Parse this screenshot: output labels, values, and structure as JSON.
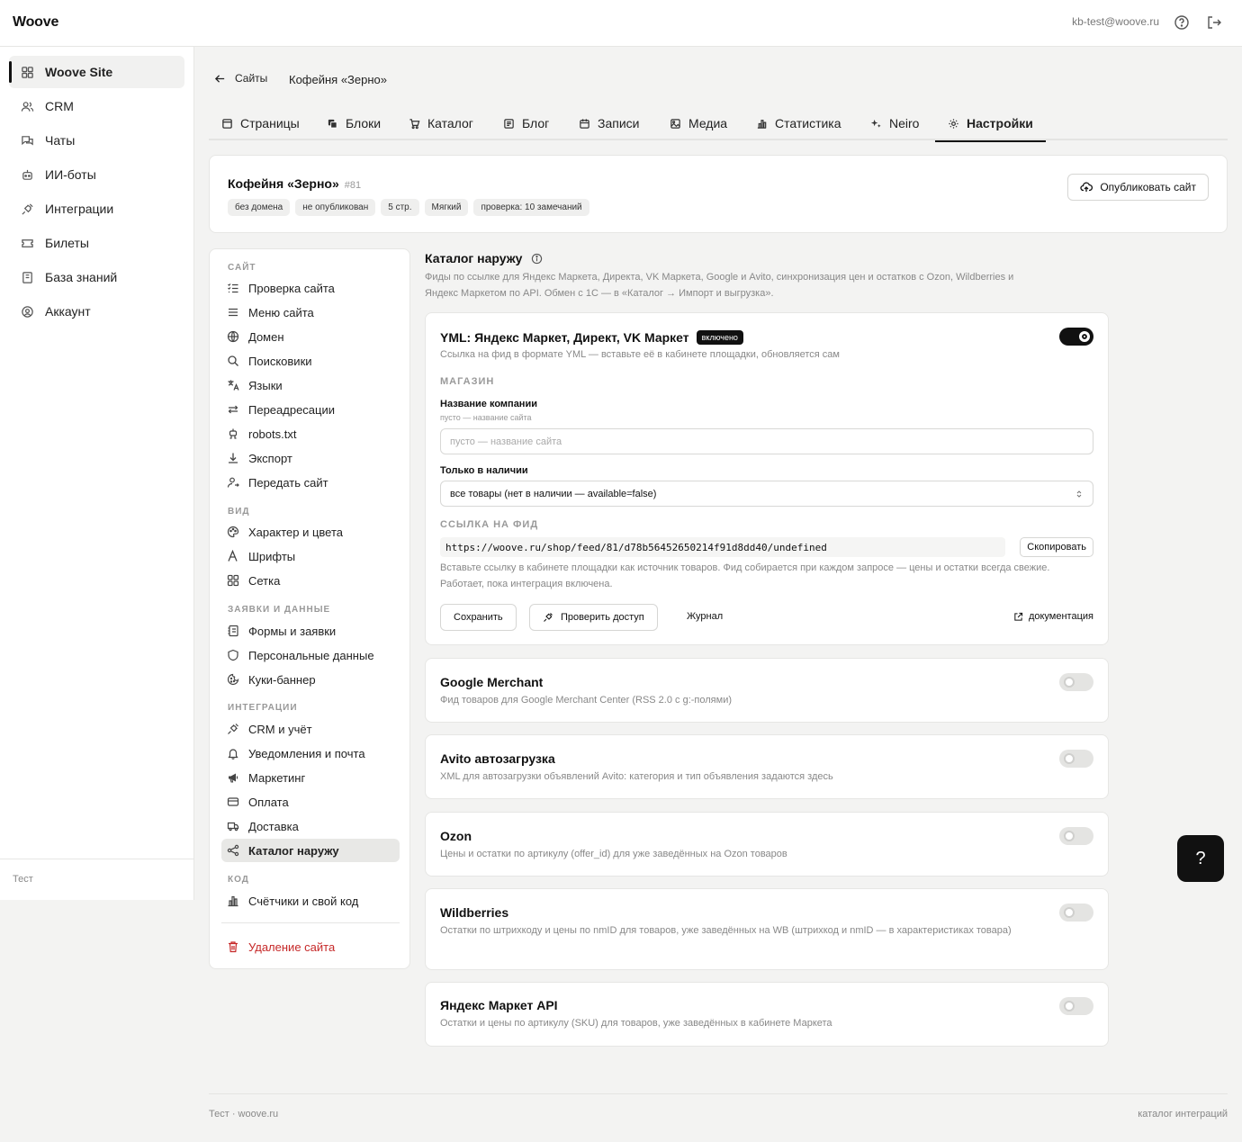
{
  "app": {
    "logo": "Woove",
    "user_email": "kb-test@woove.ru"
  },
  "icons": {
    "help": "help-circle-icon",
    "logout": "logout-icon"
  },
  "sidebar": {
    "items": [
      {
        "label": "Woove Site",
        "icon": "grid-icon"
      },
      {
        "label": "CRM",
        "icon": "users-icon"
      },
      {
        "label": "Чаты",
        "icon": "chat-icon"
      },
      {
        "label": "ИИ-боты",
        "icon": "bot-icon"
      },
      {
        "label": "Интеграции",
        "icon": "plug-icon"
      },
      {
        "label": "Билеты",
        "icon": "ticket-icon"
      },
      {
        "label": "База знаний",
        "icon": "book-icon"
      },
      {
        "label": "Аккаунт",
        "icon": "account-icon"
      }
    ],
    "footer": "Тест"
  },
  "breadcrumb": {
    "back_label": "Сайты",
    "current": "Кофейня «Зерно»"
  },
  "tabs": [
    {
      "label": "Страницы",
      "icon": "page-icon"
    },
    {
      "label": "Блоки",
      "icon": "blocks-icon"
    },
    {
      "label": "Каталог",
      "icon": "cart-icon"
    },
    {
      "label": "Блог",
      "icon": "blog-icon"
    },
    {
      "label": "Записи",
      "icon": "calendar-icon"
    },
    {
      "label": "Медиа",
      "icon": "image-icon"
    },
    {
      "label": "Статистика",
      "icon": "stats-icon"
    },
    {
      "label": "Neiro",
      "icon": "sparkle-icon"
    },
    {
      "label": "Настройки",
      "icon": "gear-icon"
    }
  ],
  "site": {
    "name": "Кофейня «Зерно»",
    "id": "#81",
    "badges": [
      "без домена",
      "не опубликован",
      "5 стр.",
      "Мягкий",
      "проверка: 10 замечаний"
    ],
    "publish_label": "Опубликовать сайт"
  },
  "settings_menu": {
    "sections": [
      "САЙТ",
      "ВИД",
      "ЗАЯВКИ И ДАННЫЕ",
      "ИНТЕГРАЦИИ",
      "КОД"
    ],
    "items": [
      {
        "label": "Проверка сайта",
        "icon": "checklist-icon"
      },
      {
        "label": "Меню сайта",
        "icon": "menu-icon"
      },
      {
        "label": "Домен",
        "icon": "globe-icon"
      },
      {
        "label": "Поисковики",
        "icon": "search-icon"
      },
      {
        "label": "Языки",
        "icon": "translate-icon"
      },
      {
        "label": "Переадресации",
        "icon": "redirect-icon"
      },
      {
        "label": "robots.txt",
        "icon": "robot-icon"
      },
      {
        "label": "Экспорт",
        "icon": "download-icon"
      },
      {
        "label": "Передать сайт",
        "icon": "user-transfer-icon"
      },
      {
        "label": "Характер и цвета",
        "icon": "palette-icon"
      },
      {
        "label": "Шрифты",
        "icon": "font-icon"
      },
      {
        "label": "Сетка",
        "icon": "grid-icon"
      },
      {
        "label": "Формы и заявки",
        "icon": "form-icon"
      },
      {
        "label": "Персональные данные",
        "icon": "shield-icon"
      },
      {
        "label": "Куки-баннер",
        "icon": "cookie-icon"
      },
      {
        "label": "CRM и учёт",
        "icon": "plug-icon"
      },
      {
        "label": "Уведомления и почта",
        "icon": "bell-icon"
      },
      {
        "label": "Маркетинг",
        "icon": "megaphone-icon"
      },
      {
        "label": "Оплата",
        "icon": "card-icon"
      },
      {
        "label": "Доставка",
        "icon": "truck-icon"
      },
      {
        "label": "Каталог наружу",
        "icon": "share-icon"
      },
      {
        "label": "Счётчики и свой код",
        "icon": "stats-icon"
      },
      {
        "label": "Удаление сайта",
        "icon": "trash-icon"
      }
    ]
  },
  "main": {
    "title": "Каталог наружу",
    "description": "Фиды по ссылке для Яндекс Маркета, Директа, VK Маркета, Google и Avito, синхронизация цен и остатков с Ozon, Wildberries и Яндекс Маркетом по API. Обмен с 1С — в «Каталог → Импорт и выгрузка».",
    "yml": {
      "title": "YML: Яндекс Маркет, Директ, VK Маркет",
      "badge": "включено",
      "enabled": true,
      "description": "Ссылка на фид в формате YML — вставьте её в кабинете площадки, обновляется сам",
      "shop_head": "МАГАЗИН",
      "company_label": "Название компании",
      "company_hint": "пусто — название сайта",
      "company_value": "",
      "company_placeholder": "пусто — название сайта",
      "stock_label": "Только в наличии",
      "stock_value": "все товары (нет в наличии — available=false)",
      "feed_head": "ССЫЛКА НА ФИД",
      "feed_url": "https://woove.ru/shop/feed/81/d78b56452650214f91d8dd40/undefined",
      "copy_label": "Скопировать",
      "feed_note": "Вставьте ссылку в кабинете площадки как источник товаров. Фид собирается при каждом запросе — цены и остатки всегда свежие. Работает, пока интеграция включена.",
      "save_label": "Сохранить",
      "check_label": "Проверить доступ",
      "log_label": "Журнал",
      "docs_label": "документация"
    },
    "integrations": [
      {
        "title": "Google Merchant",
        "description": "Фид товаров для Google Merchant Center (RSS 2.0 с g:-полями)",
        "enabled": false
      },
      {
        "title": "Avito автозагрузка",
        "description": "XML для автозагрузки объявлений Avito: категория и тип объявления задаются здесь",
        "enabled": false
      },
      {
        "title": "Ozon",
        "description": "Цены и остатки по артикулу (offer_id) для уже заведённых на Ozon товаров",
        "enabled": false
      },
      {
        "title": "Wildberries",
        "description": "Остатки по штрихкоду и цены по nmID для товаров, уже заведённых на WB (штрихкод и nmID — в характеристиках товара)",
        "enabled": false
      },
      {
        "title": "Яндекс Маркет API",
        "description": "Остатки и цены по артикулу (SKU) для товаров, уже заведённых в кабинете Маркета",
        "enabled": false
      }
    ]
  },
  "footer": {
    "left": "Тест · woove.ru",
    "right": "каталог интеграций"
  },
  "help_fab": "?"
}
